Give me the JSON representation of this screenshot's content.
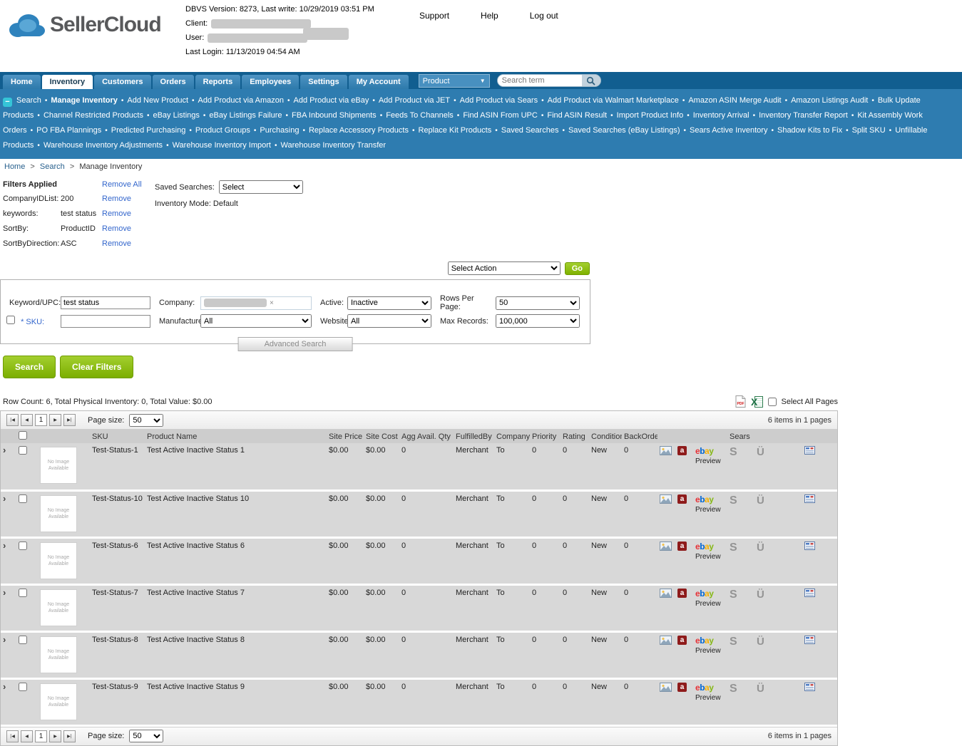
{
  "colors": {
    "nav_blue": "#115e90",
    "subnav_blue": "#2e7cb0",
    "accent_green": "#7fb200",
    "link_blue": "#3366cc"
  },
  "header": {
    "logo_text": "SellerCloud",
    "dbvs_line": "DBVS Version: 8273, Last write: 10/29/2019 03:51 PM",
    "client_label": "Client:",
    "user_label": "User:",
    "last_login": "Last Login: 11/13/2019 04:54 AM",
    "links": [
      "Support",
      "Help",
      "Log out"
    ]
  },
  "nav": {
    "tabs": [
      "Home",
      "Inventory",
      "Customers",
      "Orders",
      "Reports",
      "Employees",
      "Settings",
      "My Account"
    ],
    "active_tab": "Inventory",
    "product_menu": "Product",
    "product_arrow": "▼",
    "search_placeholder": "Search term"
  },
  "subnav": {
    "bullet": "•",
    "collapse_glyph": "−",
    "items": [
      "Search",
      "Manage Inventory",
      "Add New Product",
      "Add Product via Amazon",
      "Add Product via eBay",
      "Add Product via JET",
      "Add Product via Sears",
      "Add Product via Walmart Marketplace",
      "Amazon ASIN Merge Audit",
      "Amazon Listings Audit",
      "Bulk Update Products",
      "Channel Restricted Products",
      "eBay Listings",
      "eBay Listings Failure",
      "FBA Inbound Shipments",
      "Feeds To Channels",
      "Find ASIN From UPC",
      "Find ASIN Result",
      "Import Product Info",
      "Inventory Arrival",
      "Inventory Transfer Report",
      "Kit Assembly Work Orders",
      "PO FBA Plannings",
      "Predicted Purchasing",
      "Product Groups",
      "Purchasing",
      "Replace Accessory Products",
      "Replace Kit Products",
      "Saved Searches",
      "Saved Searches (eBay Listings)",
      "Sears Active Inventory",
      "Shadow Kits to Fix",
      "Split SKU",
      "Unfillable Products",
      "Warehouse Inventory Adjustments",
      "Warehouse Inventory Import",
      "Warehouse Inventory Transfer"
    ]
  },
  "breadcrumb": {
    "items": [
      "Home",
      "Search",
      "Manage Inventory"
    ],
    "separator": ">"
  },
  "filters": {
    "title": "Filters Applied",
    "remove_all_label": "Remove All",
    "remove_label": "Remove",
    "applied": [
      {
        "label": "CompanyIDList:",
        "value": "200"
      },
      {
        "label": "keywords:",
        "value": "test status"
      },
      {
        "label": "SortBy:",
        "value": "ProductID"
      },
      {
        "label": "SortByDirection:",
        "value": "ASC"
      }
    ],
    "saved_searches_label": "Saved Searches:",
    "saved_searches_value": "Select",
    "inventory_mode": "Inventory Mode: Default"
  },
  "action_bar": {
    "select_action_value": "Select Action",
    "go_label": "Go"
  },
  "search_panel": {
    "keyword_label": "Keyword/UPC:",
    "keyword_value": "test status",
    "company_label": "Company:",
    "company_clear_glyph": "×",
    "active_label": "Active:",
    "active_value": "Inactive",
    "rows_per_page_label": "Rows Per Page:",
    "rows_per_page_value": "50",
    "sku_label": "* SKU:",
    "sku_value": "",
    "manufacturer_label": "Manufacturer:",
    "manufacturer_value": "All",
    "website_label": "Website:",
    "website_value": "All",
    "max_records_label": "Max Records:",
    "max_records_value": "100,000",
    "advanced_search_label": "Advanced Search",
    "search_button": "Search",
    "clear_button": "Clear Filters"
  },
  "summary": {
    "text": "Row Count: 6, Total Physical Inventory: 0, Total Value: $0.00",
    "select_all_label": "Select All Pages"
  },
  "grid": {
    "page_size_label": "Page size:",
    "page_size_value": "50",
    "current_page": "1",
    "items_info": "6 items in 1 pages",
    "pager_icons": {
      "first": "|◀",
      "prev": "◀",
      "next": "▶",
      "last": "▶|"
    },
    "columns": [
      "SKU",
      "Product Name",
      "Site Price",
      "Site Cost",
      "Agg Avail. Qty",
      "FulfilledBy",
      "Company",
      "Priority",
      "Rating",
      "Condition",
      "BackOrder",
      "Sears"
    ],
    "no_image_label": "No Image Available",
    "preview_label": "Preview",
    "rows": [
      {
        "sku": "Test-Status-1",
        "name": "Test Active Inactive Status 1",
        "site_price": "$0.00",
        "site_cost": "$0.00",
        "agg_qty": "0",
        "fulfilled_by": "Merchant",
        "company": "To",
        "priority": "0",
        "rating": "0",
        "condition": "New",
        "backorder": "0"
      },
      {
        "sku": "Test-Status-10",
        "name": "Test Active Inactive Status 10",
        "site_price": "$0.00",
        "site_cost": "$0.00",
        "agg_qty": "0",
        "fulfilled_by": "Merchant",
        "company": "To",
        "priority": "0",
        "rating": "0",
        "condition": "New",
        "backorder": "0"
      },
      {
        "sku": "Test-Status-6",
        "name": "Test Active Inactive Status 6",
        "site_price": "$0.00",
        "site_cost": "$0.00",
        "agg_qty": "0",
        "fulfilled_by": "Merchant",
        "company": "To",
        "priority": "0",
        "rating": "0",
        "condition": "New",
        "backorder": "0"
      },
      {
        "sku": "Test-Status-7",
        "name": "Test Active Inactive Status 7",
        "site_price": "$0.00",
        "site_cost": "$0.00",
        "agg_qty": "0",
        "fulfilled_by": "Merchant",
        "company": "To",
        "priority": "0",
        "rating": "0",
        "condition": "New",
        "backorder": "0"
      },
      {
        "sku": "Test-Status-8",
        "name": "Test Active Inactive Status 8",
        "site_price": "$0.00",
        "site_cost": "$0.00",
        "agg_qty": "0",
        "fulfilled_by": "Merchant",
        "company": "To",
        "priority": "0",
        "rating": "0",
        "condition": "New",
        "backorder": "0"
      },
      {
        "sku": "Test-Status-9",
        "name": "Test Active Inactive Status 9",
        "site_price": "$0.00",
        "site_cost": "$0.00",
        "agg_qty": "0",
        "fulfilled_by": "Merchant",
        "company": "To",
        "priority": "0",
        "rating": "0",
        "condition": "New",
        "backorder": "0"
      }
    ]
  },
  "icons": {
    "ebay_letters": [
      "e",
      "b",
      "a",
      "y"
    ],
    "amazon_letter": "a",
    "sears_letter": "S",
    "u_letter": "Ü"
  }
}
